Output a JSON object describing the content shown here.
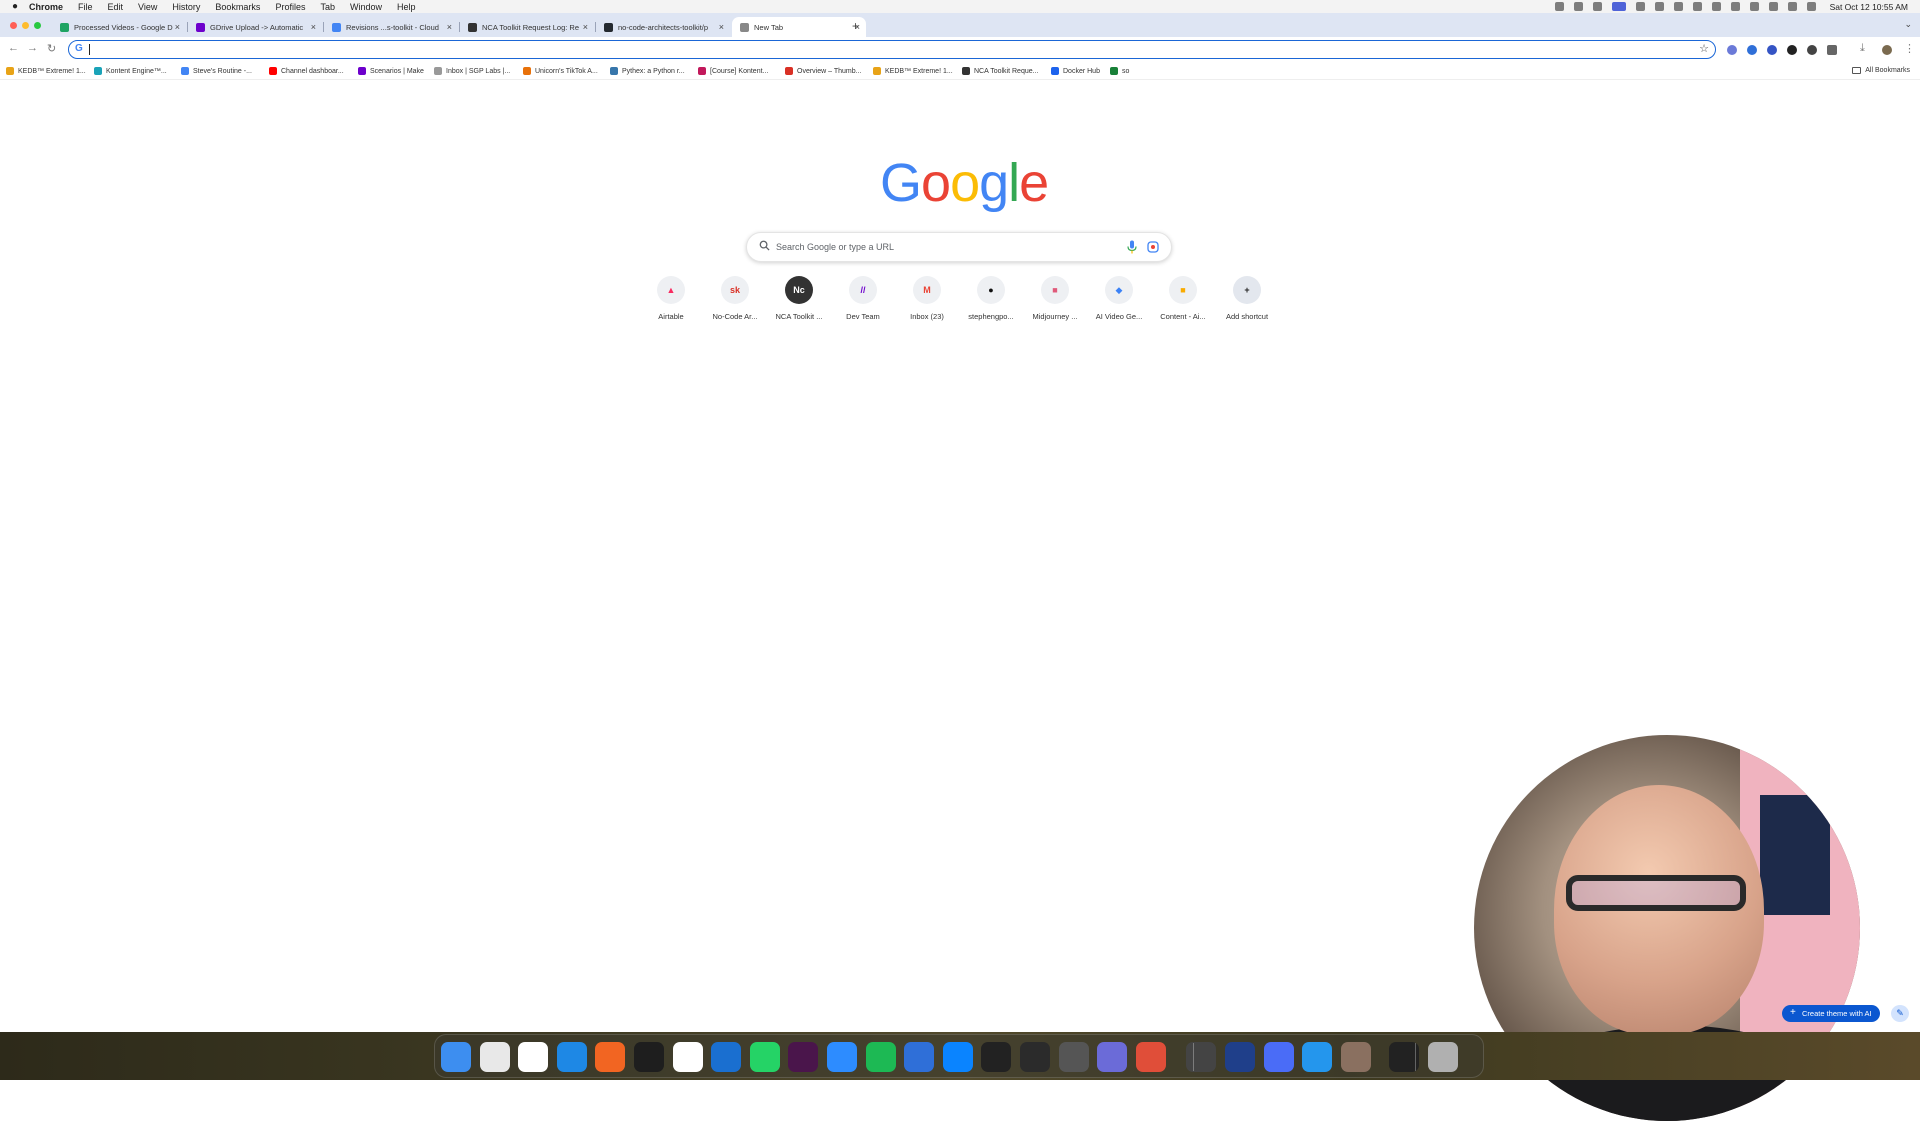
{
  "menubar": {
    "items": [
      "Chrome",
      "File",
      "Edit",
      "View",
      "History",
      "Bookmarks",
      "Profiles",
      "Tab",
      "Window",
      "Help"
    ],
    "clock": "Sat Oct 12  10:55 AM"
  },
  "tabs": [
    {
      "title": "Processed Videos - Google D",
      "color": "#1fa463"
    },
    {
      "title": "GDrive Upload -> Automatic",
      "color": "#6d00cc"
    },
    {
      "title": "Revisions ...s-toolkit - Cloud",
      "color": "#4285f4"
    },
    {
      "title": "NCA Toolkit Request Log: Re",
      "color": "#333333"
    },
    {
      "title": "no-code-architects-toolkit/p",
      "color": "#24292f"
    },
    {
      "title": "New Tab",
      "color": "#888888",
      "active": true
    }
  ],
  "omnibox": {
    "value": ""
  },
  "bookmarks": [
    {
      "label": "KEDB™ Extreme! 1...",
      "color": "#e8a317"
    },
    {
      "label": "Kontent Engine™...",
      "color": "#1aa3b8"
    },
    {
      "label": "Steve's Routine -...",
      "color": "#4285f4"
    },
    {
      "label": "Channel dashboar...",
      "color": "#ff0000"
    },
    {
      "label": "Scenarios | Make",
      "color": "#6d00cc"
    },
    {
      "label": "Inbox | SGP Labs |...",
      "color": "#999999"
    },
    {
      "label": "Unicorn's TikTok A...",
      "color": "#e8710a"
    },
    {
      "label": "Pythex: a Python r...",
      "color": "#3776ab"
    },
    {
      "label": "[Course] Kontent...",
      "color": "#c2185b"
    },
    {
      "label": "Overview – Thumb...",
      "color": "#d93025"
    },
    {
      "label": "KEDB™ Extreme! 1...",
      "color": "#e8a317"
    },
    {
      "label": "NCA Toolkit Reque...",
      "color": "#333333"
    },
    {
      "label": "Docker Hub",
      "color": "#1d63ed"
    },
    {
      "label": "so",
      "color": "#188038"
    }
  ],
  "all_bookmarks": "All Bookmarks",
  "google": {
    "letters": [
      {
        "ch": "G",
        "color": "#4285f4"
      },
      {
        "ch": "o",
        "color": "#ea4335"
      },
      {
        "ch": "o",
        "color": "#fbbc05"
      },
      {
        "ch": "g",
        "color": "#4285f4"
      },
      {
        "ch": "l",
        "color": "#34a853"
      },
      {
        "ch": "e",
        "color": "#ea4335"
      }
    ],
    "search_placeholder": "Search Google or type a URL"
  },
  "shortcuts": [
    {
      "label": "Airtable",
      "glyph": "▲",
      "color": "#f82b60"
    },
    {
      "label": "No-Code Ar...",
      "glyph": "sk",
      "color": "#d93025"
    },
    {
      "label": "NCA Toolkit ...",
      "glyph": "Nc",
      "color": "#ffffff",
      "bg": "#333333"
    },
    {
      "label": "Dev Team",
      "glyph": "//",
      "color": "#6d00cc"
    },
    {
      "label": "Inbox (23)",
      "glyph": "M",
      "color": "#ea4335"
    },
    {
      "label": "stephengpo...",
      "glyph": "●",
      "color": "#111111"
    },
    {
      "label": "Midjourney ...",
      "glyph": "■",
      "color": "#e05a7a"
    },
    {
      "label": "AI Video Ge...",
      "glyph": "◆",
      "color": "#3b82f6"
    },
    {
      "label": "Content - Ai...",
      "glyph": "■",
      "color": "#f9ab00"
    },
    {
      "label": "Add shortcut",
      "glyph": "+",
      "color": "#1f1f1f"
    }
  ],
  "theme_button": "Create theme with AI",
  "dock_colors": [
    "#3d8ef0",
    "#e8e8e8",
    "#ffffff",
    "#1e88e5",
    "#f26522",
    "#1e1e1e",
    "#ffffff",
    "#1a6fd0",
    "#25d366",
    "#4a154b",
    "#2d8cff",
    "#1db954",
    "#2f6fd8",
    "#0a84ff",
    "#222222",
    "#2b2b2b",
    "#555555",
    "#6b6bd8",
    "#e04e39",
    "#444444",
    "#1f3f8a",
    "#4a6cf7",
    "#2496ed",
    "#8a7060",
    "#222222",
    "#b0b0b0"
  ]
}
